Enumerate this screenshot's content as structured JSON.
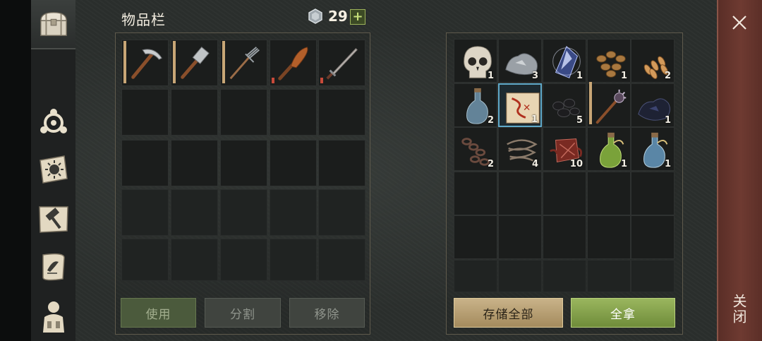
{
  "header": {
    "title": "物品栏",
    "coins": "29",
    "plus": "+"
  },
  "close": {
    "vertical_label": "关闭"
  },
  "sidebar": {
    "items": [
      {
        "icon": "chest-icon"
      },
      {
        "icon": "crafting-tree-icon"
      },
      {
        "icon": "sun-journal-icon"
      },
      {
        "icon": "hammer-map-icon"
      },
      {
        "icon": "quest-scroll-icon"
      },
      {
        "icon": "character-icon"
      }
    ]
  },
  "inventory": {
    "items": [
      {
        "name": "pickaxe",
        "durability": "full"
      },
      {
        "name": "hammer",
        "durability": "full"
      },
      {
        "name": "pitchfork",
        "durability": "full"
      },
      {
        "name": "club",
        "durability": "low"
      },
      {
        "name": "sword",
        "durability": "low"
      }
    ]
  },
  "container": {
    "items": [
      {
        "name": "skull",
        "qty": "1"
      },
      {
        "name": "silver-ore",
        "qty": "3"
      },
      {
        "name": "crystal-shard",
        "qty": "1"
      },
      {
        "name": "beans",
        "qty": "1"
      },
      {
        "name": "wheat-seeds",
        "qty": "2"
      },
      {
        "name": "empty-flask",
        "qty": "2"
      },
      {
        "name": "treasure-map",
        "qty": "1"
      },
      {
        "name": "coal",
        "qty": "5"
      },
      {
        "name": "spiked-mace",
        "qty": ""
      },
      {
        "name": "dark-ore",
        "qty": "1"
      },
      {
        "name": "chain",
        "qty": "2"
      },
      {
        "name": "rope",
        "qty": "4"
      },
      {
        "name": "red-cloth",
        "qty": "10"
      },
      {
        "name": "green-potion",
        "qty": "1"
      },
      {
        "name": "water-flask",
        "qty": "1"
      }
    ]
  },
  "buttons": {
    "use": "使用",
    "split": "分割",
    "remove": "移除",
    "store_all": "存储全部",
    "take_all": "全拿"
  },
  "colors": {
    "accent_green": "#8aa84e",
    "close_red": "#6e3a31",
    "selected_blue": "#5fa9c9"
  }
}
